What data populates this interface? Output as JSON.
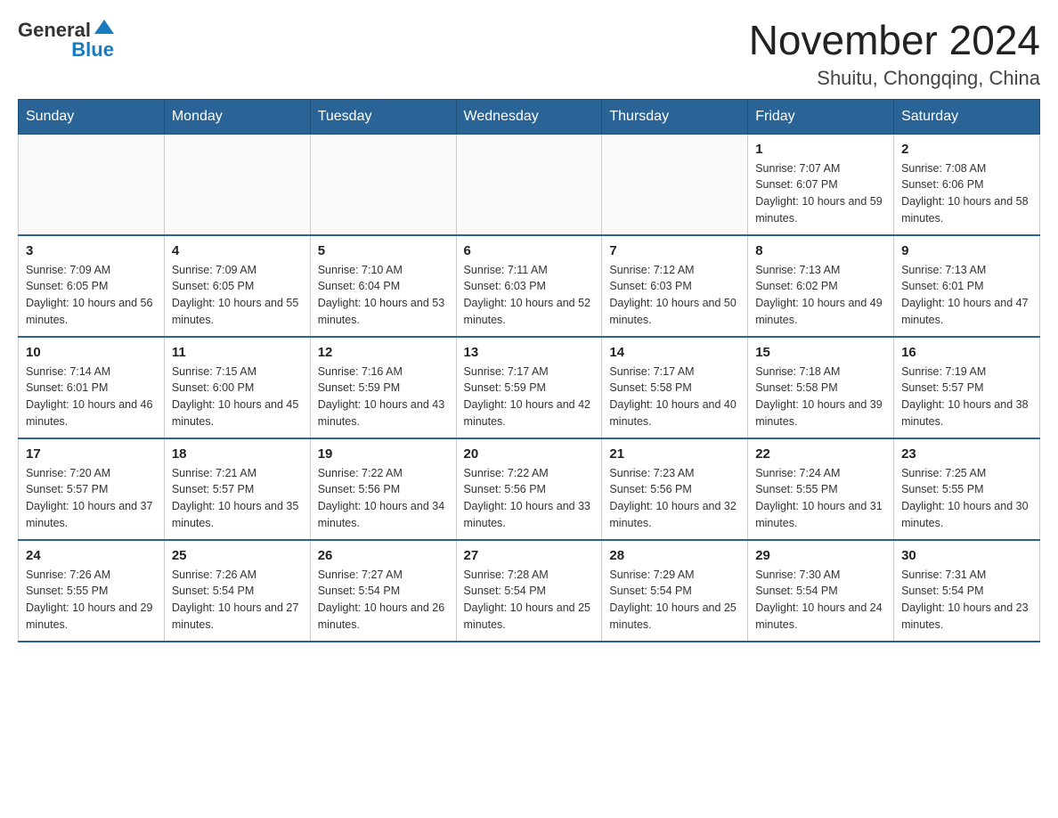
{
  "header": {
    "logo": {
      "general": "General",
      "blue": "Blue"
    },
    "month_title": "November 2024",
    "location": "Shuitu, Chongqing, China"
  },
  "weekdays": [
    "Sunday",
    "Monday",
    "Tuesday",
    "Wednesday",
    "Thursday",
    "Friday",
    "Saturday"
  ],
  "weeks": [
    [
      {
        "day": "",
        "info": ""
      },
      {
        "day": "",
        "info": ""
      },
      {
        "day": "",
        "info": ""
      },
      {
        "day": "",
        "info": ""
      },
      {
        "day": "",
        "info": ""
      },
      {
        "day": "1",
        "info": "Sunrise: 7:07 AM\nSunset: 6:07 PM\nDaylight: 10 hours and 59 minutes."
      },
      {
        "day": "2",
        "info": "Sunrise: 7:08 AM\nSunset: 6:06 PM\nDaylight: 10 hours and 58 minutes."
      }
    ],
    [
      {
        "day": "3",
        "info": "Sunrise: 7:09 AM\nSunset: 6:05 PM\nDaylight: 10 hours and 56 minutes."
      },
      {
        "day": "4",
        "info": "Sunrise: 7:09 AM\nSunset: 6:05 PM\nDaylight: 10 hours and 55 minutes."
      },
      {
        "day": "5",
        "info": "Sunrise: 7:10 AM\nSunset: 6:04 PM\nDaylight: 10 hours and 53 minutes."
      },
      {
        "day": "6",
        "info": "Sunrise: 7:11 AM\nSunset: 6:03 PM\nDaylight: 10 hours and 52 minutes."
      },
      {
        "day": "7",
        "info": "Sunrise: 7:12 AM\nSunset: 6:03 PM\nDaylight: 10 hours and 50 minutes."
      },
      {
        "day": "8",
        "info": "Sunrise: 7:13 AM\nSunset: 6:02 PM\nDaylight: 10 hours and 49 minutes."
      },
      {
        "day": "9",
        "info": "Sunrise: 7:13 AM\nSunset: 6:01 PM\nDaylight: 10 hours and 47 minutes."
      }
    ],
    [
      {
        "day": "10",
        "info": "Sunrise: 7:14 AM\nSunset: 6:01 PM\nDaylight: 10 hours and 46 minutes."
      },
      {
        "day": "11",
        "info": "Sunrise: 7:15 AM\nSunset: 6:00 PM\nDaylight: 10 hours and 45 minutes."
      },
      {
        "day": "12",
        "info": "Sunrise: 7:16 AM\nSunset: 5:59 PM\nDaylight: 10 hours and 43 minutes."
      },
      {
        "day": "13",
        "info": "Sunrise: 7:17 AM\nSunset: 5:59 PM\nDaylight: 10 hours and 42 minutes."
      },
      {
        "day": "14",
        "info": "Sunrise: 7:17 AM\nSunset: 5:58 PM\nDaylight: 10 hours and 40 minutes."
      },
      {
        "day": "15",
        "info": "Sunrise: 7:18 AM\nSunset: 5:58 PM\nDaylight: 10 hours and 39 minutes."
      },
      {
        "day": "16",
        "info": "Sunrise: 7:19 AM\nSunset: 5:57 PM\nDaylight: 10 hours and 38 minutes."
      }
    ],
    [
      {
        "day": "17",
        "info": "Sunrise: 7:20 AM\nSunset: 5:57 PM\nDaylight: 10 hours and 37 minutes."
      },
      {
        "day": "18",
        "info": "Sunrise: 7:21 AM\nSunset: 5:57 PM\nDaylight: 10 hours and 35 minutes."
      },
      {
        "day": "19",
        "info": "Sunrise: 7:22 AM\nSunset: 5:56 PM\nDaylight: 10 hours and 34 minutes."
      },
      {
        "day": "20",
        "info": "Sunrise: 7:22 AM\nSunset: 5:56 PM\nDaylight: 10 hours and 33 minutes."
      },
      {
        "day": "21",
        "info": "Sunrise: 7:23 AM\nSunset: 5:56 PM\nDaylight: 10 hours and 32 minutes."
      },
      {
        "day": "22",
        "info": "Sunrise: 7:24 AM\nSunset: 5:55 PM\nDaylight: 10 hours and 31 minutes."
      },
      {
        "day": "23",
        "info": "Sunrise: 7:25 AM\nSunset: 5:55 PM\nDaylight: 10 hours and 30 minutes."
      }
    ],
    [
      {
        "day": "24",
        "info": "Sunrise: 7:26 AM\nSunset: 5:55 PM\nDaylight: 10 hours and 29 minutes."
      },
      {
        "day": "25",
        "info": "Sunrise: 7:26 AM\nSunset: 5:54 PM\nDaylight: 10 hours and 27 minutes."
      },
      {
        "day": "26",
        "info": "Sunrise: 7:27 AM\nSunset: 5:54 PM\nDaylight: 10 hours and 26 minutes."
      },
      {
        "day": "27",
        "info": "Sunrise: 7:28 AM\nSunset: 5:54 PM\nDaylight: 10 hours and 25 minutes."
      },
      {
        "day": "28",
        "info": "Sunrise: 7:29 AM\nSunset: 5:54 PM\nDaylight: 10 hours and 25 minutes."
      },
      {
        "day": "29",
        "info": "Sunrise: 7:30 AM\nSunset: 5:54 PM\nDaylight: 10 hours and 24 minutes."
      },
      {
        "day": "30",
        "info": "Sunrise: 7:31 AM\nSunset: 5:54 PM\nDaylight: 10 hours and 23 minutes."
      }
    ]
  ]
}
